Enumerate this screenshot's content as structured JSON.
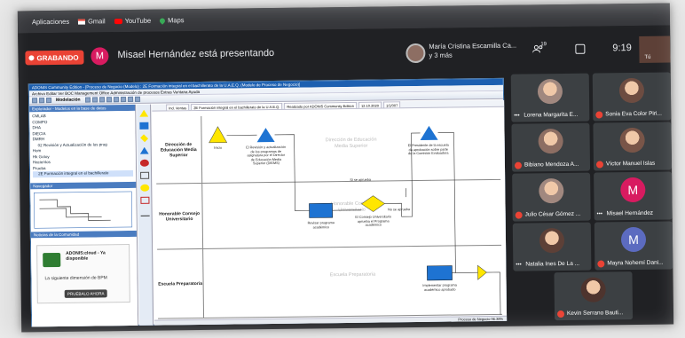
{
  "bookmarks": {
    "apps": "Aplicaciones",
    "gmail": "Gmail",
    "youtube": "YouTube",
    "maps": "Maps"
  },
  "meet": {
    "recording_label": "GRABANDO",
    "presenter_initial": "M",
    "presenter_text": "Misael Hernández está presentando",
    "pinned_line1": "María Cristina Escamilla Ca...",
    "pinned_line2": "y 3 más",
    "people_count": "19",
    "clock": "9:19",
    "self_label": "Tú",
    "colors": {
      "recording": "#ea4335",
      "presenter_avatar": "#d81b60",
      "background": "#202124"
    }
  },
  "app": {
    "title": "ADONIS Community Edition - [Proceso de Negocio (Modelo) : 2E Formación integral en el bachillerato de la U.A.E.Q. (Modelo de Proceso de Negocio)]",
    "menu": "Archivo  Editar  Ver  BOC Management Office  Administración de procesos  Extras  Ventana  Ayuda",
    "module_label": "Modelación",
    "explorer_header": "Explorador - Modelos en la base de datos",
    "tree": [
      "CMLAB",
      "COMPO",
      "DHA",
      "DIECIA",
      "DMRH",
      "02 Revisión y Actualización de los prog",
      "Hom",
      "Hk Gotoy",
      "Hacientos",
      "Prueba",
      "2E Formación integral en el bachillerato"
    ],
    "navigator_header": "Navegador",
    "community_header": "Noticias de la Comunidad",
    "promo_title": "ADONIS:cloud - Ya disponible",
    "promo_sub": "La siguiente dimensión de BPM",
    "promo_button": "PRUÉBALO AHORA",
    "tabs": [
      "Ind. Ventas",
      "2E Formación integral en el bachillerato de la U.A.E.Q.",
      "Realizado por ADONIS Community Edition",
      "12.10.2020",
      "1/1/007"
    ],
    "lanes": [
      {
        "label": "Dirección de Educación Media Superior",
        "watermark": "Dirección de Educación Media Superior"
      },
      {
        "label": "Honorable Consejo Universitario",
        "watermark": "Honorable Consejo Universitario"
      },
      {
        "label": "Escuela Preparatoria",
        "watermark": "Escuela Preparatoria"
      }
    ],
    "nodes": {
      "start": "Inicio",
      "task1": "El Revisión y actualización de los programas de asignatura por el Director de Educación Media Superior (DIEMS)",
      "task2": "El Presidente de la escuela da aprobación sobre parte de la Comisión Evaluadora",
      "yes_label": "Sí se aprueba",
      "task3": "Revisar programa académico",
      "decision": "El Consejo Universitario aprueba el Programa académico",
      "no_label": "No se aprueba",
      "task4": "Implementar programa académico aprobado"
    },
    "status": "Proceso de Negocio 96.38%"
  },
  "participants": [
    {
      "name": "Lorena Margarita E...",
      "type": "photo",
      "color": "#a1887f",
      "muted": false
    },
    {
      "name": "Sonia Eva Color Piri...",
      "type": "photo",
      "color": "#6d4c41",
      "muted": true
    },
    {
      "name": "Bibiano Mendoza A...",
      "type": "photo",
      "color": "#8d6e63",
      "muted": true
    },
    {
      "name": "Víctor Manuel Islas",
      "type": "photo",
      "color": "#795548",
      "muted": true
    },
    {
      "name": "Julio César Gómez ...",
      "type": "photo",
      "color": "#a1887f",
      "muted": true
    },
    {
      "name": "Misael Hernández",
      "type": "avatar",
      "initial": "M",
      "color": "#d81b60",
      "muted": false
    },
    {
      "name": "Natalia Ines De La ...",
      "type": "photo",
      "color": "#5d4037",
      "muted": false
    },
    {
      "name": "Mayra Nohemí Dani...",
      "type": "avatar",
      "initial": "M",
      "color": "#5c6bc0",
      "muted": true
    },
    {
      "name": "Kevin Serrano Bauti...",
      "type": "photo",
      "color": "#4e342e",
      "muted": true
    }
  ]
}
